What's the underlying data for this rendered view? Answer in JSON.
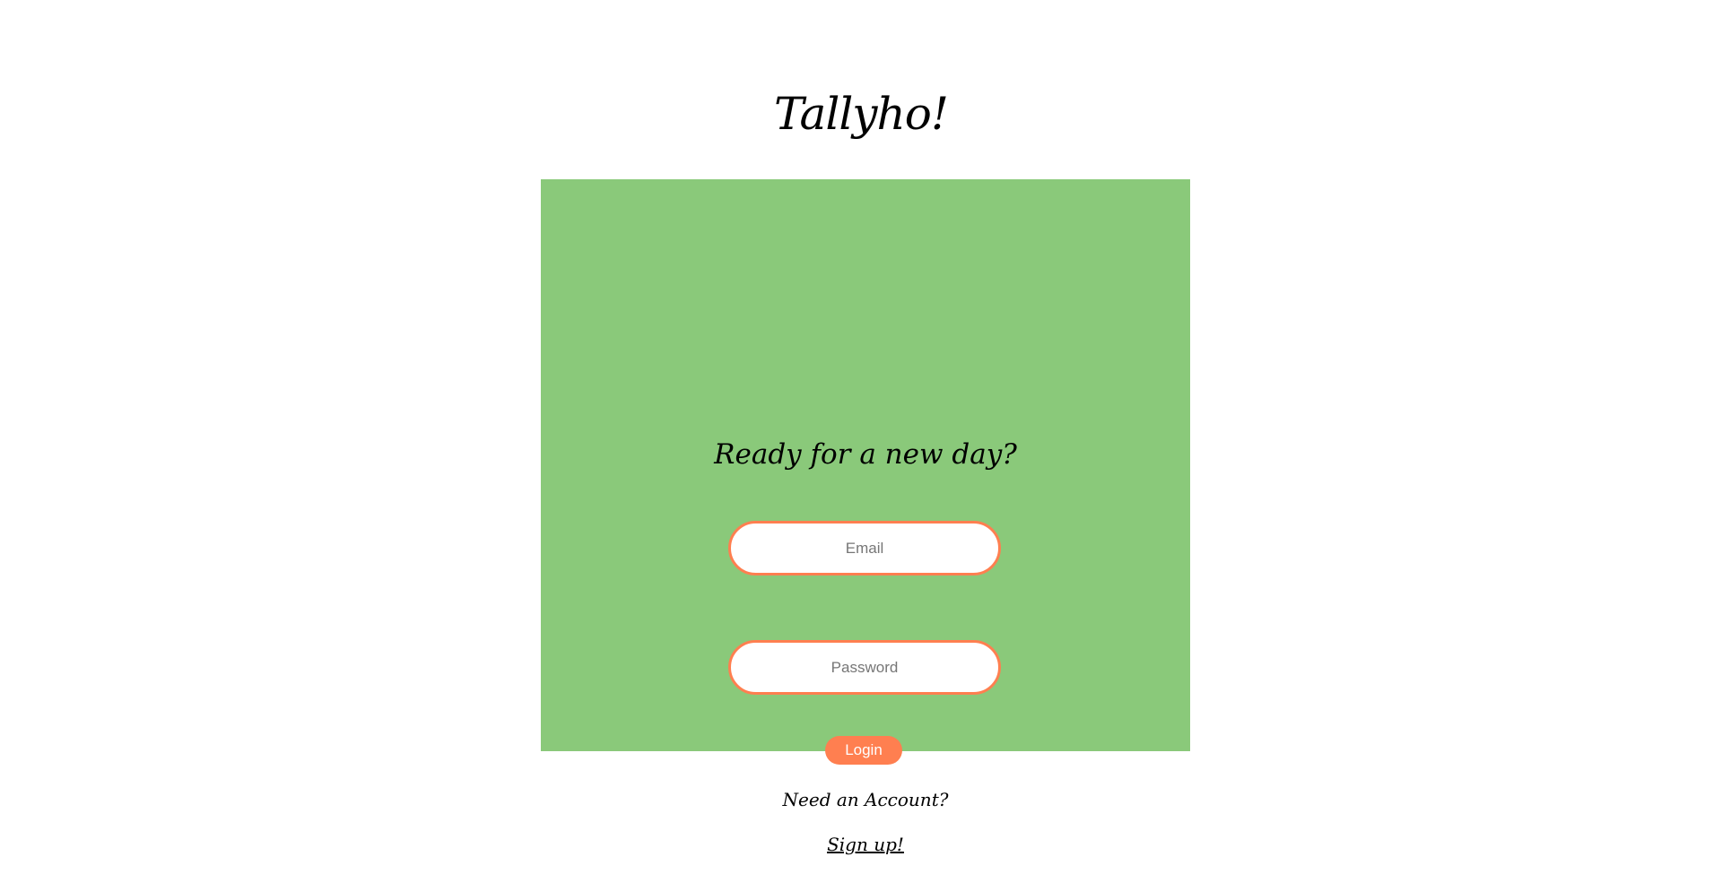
{
  "header": {
    "app_title": "Tallyho!"
  },
  "login_card": {
    "heading": "Ready for a new day?",
    "email_placeholder": "Email",
    "email_value": "",
    "password_placeholder": "Password",
    "password_value": "",
    "login_label": "Login",
    "need_account_text": "Need an Account?",
    "signup_label": "Sign up!"
  },
  "colors": {
    "card_background": "#8ac97a",
    "accent": "#ff7f50",
    "page_background": "#ffffff"
  }
}
